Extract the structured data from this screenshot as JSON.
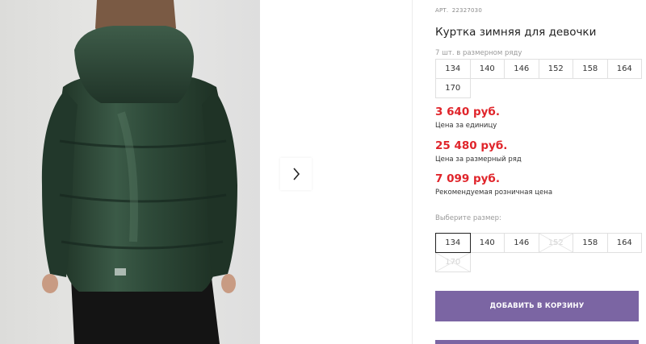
{
  "product": {
    "article_label": "АРТ.",
    "article_number": "22327030",
    "title": "Куртка зимняя для девочки"
  },
  "series": {
    "label": "7 шт. в размерном ряду",
    "sizes": [
      "134",
      "140",
      "146",
      "152",
      "158",
      "164",
      "170"
    ]
  },
  "prices": [
    {
      "value": "3 640 руб.",
      "caption": "Цена за единицу"
    },
    {
      "value": "25 480 руб.",
      "caption": "Цена за размерный ряд"
    },
    {
      "value": "7 099 руб.",
      "caption": "Рекомендуемая розничная цена"
    }
  ],
  "size_select": {
    "label": "Выберите размер:",
    "options": [
      {
        "label": "134",
        "state": "selected"
      },
      {
        "label": "140",
        "state": "available"
      },
      {
        "label": "146",
        "state": "available"
      },
      {
        "label": "152",
        "state": "unavailable"
      },
      {
        "label": "158",
        "state": "available"
      },
      {
        "label": "164",
        "state": "available"
      },
      {
        "label": "170",
        "state": "unavailable"
      }
    ]
  },
  "cart_button_label": "Добавить в корзину",
  "icons": {
    "next": "chevron-right-icon"
  },
  "colors": {
    "price": "#e0252b",
    "button": "#7b65a3",
    "jacket": "#2b4433"
  }
}
